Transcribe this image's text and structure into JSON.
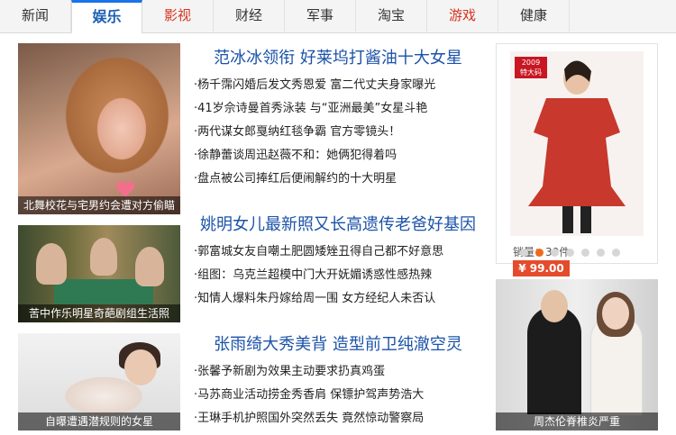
{
  "tabs": [
    {
      "label": "新闻",
      "style": "normal"
    },
    {
      "label": "娱乐",
      "style": "active"
    },
    {
      "label": "影视",
      "style": "red"
    },
    {
      "label": "财经",
      "style": "normal"
    },
    {
      "label": "军事",
      "style": "normal"
    },
    {
      "label": "淘宝",
      "style": "normal"
    },
    {
      "label": "游戏",
      "style": "red"
    },
    {
      "label": "健康",
      "style": "normal"
    }
  ],
  "photos": {
    "p1_caption": "北舞校花与宅男约会遭对方偷瞄",
    "p2_caption": "苦中作乐明星奇葩剧组生活照",
    "p3_caption": "自曝遭遇潜规则的女星",
    "p4_caption": "周杰伦脊椎炎严重"
  },
  "sections": [
    {
      "headline": "范冰冰领衔 好莱坞打酱油十大女星",
      "items": [
        "·杨千霈闪婚后发文秀恩爱 富二代丈夫身家曝光",
        "·41岁佘诗曼首秀泳装 与“亚洲最美”女星斗艳",
        "·两代谋女郎戛纳红毯争霸 官方零镜头！",
        "·徐静蕾谈周迅赵薇不和：她俩犯得着吗",
        "·盘点被公司捧红后便闹解约的十大明星"
      ]
    },
    {
      "headline": "姚明女儿最新照又长高遗传老爸好基因",
      "items": [
        "·郭富城女友自嘲土肥圆矮矬丑得自己都不好意思",
        "·组图：乌克兰超模中门大开妩媚诱惑性感热辣",
        "·知情人爆料朱丹嫁给周一围 女方经纪人未否认"
      ]
    },
    {
      "headline": "张雨绮大秀美背 造型前卫纯澈空灵",
      "items": [
        "·张馨予新剧为效果主动要求扔真鸡蛋",
        "·马苏商业活动捞金秀香肩 保镖护驾声势浩大",
        "·王琳手机护照国外突然丢失 竟然惊动警察局"
      ]
    }
  ],
  "ad": {
    "badge_year": "2009",
    "badge_text": "特大码",
    "sales": "销量：39件",
    "price": "¥ 99.00",
    "dot_count": 7,
    "active_dot": 2
  },
  "colors": {
    "accent_blue": "#1a5fb4",
    "tab_red": "#d6331f",
    "price_bg": "#e44b2c",
    "dot_active": "#f06a1e"
  }
}
